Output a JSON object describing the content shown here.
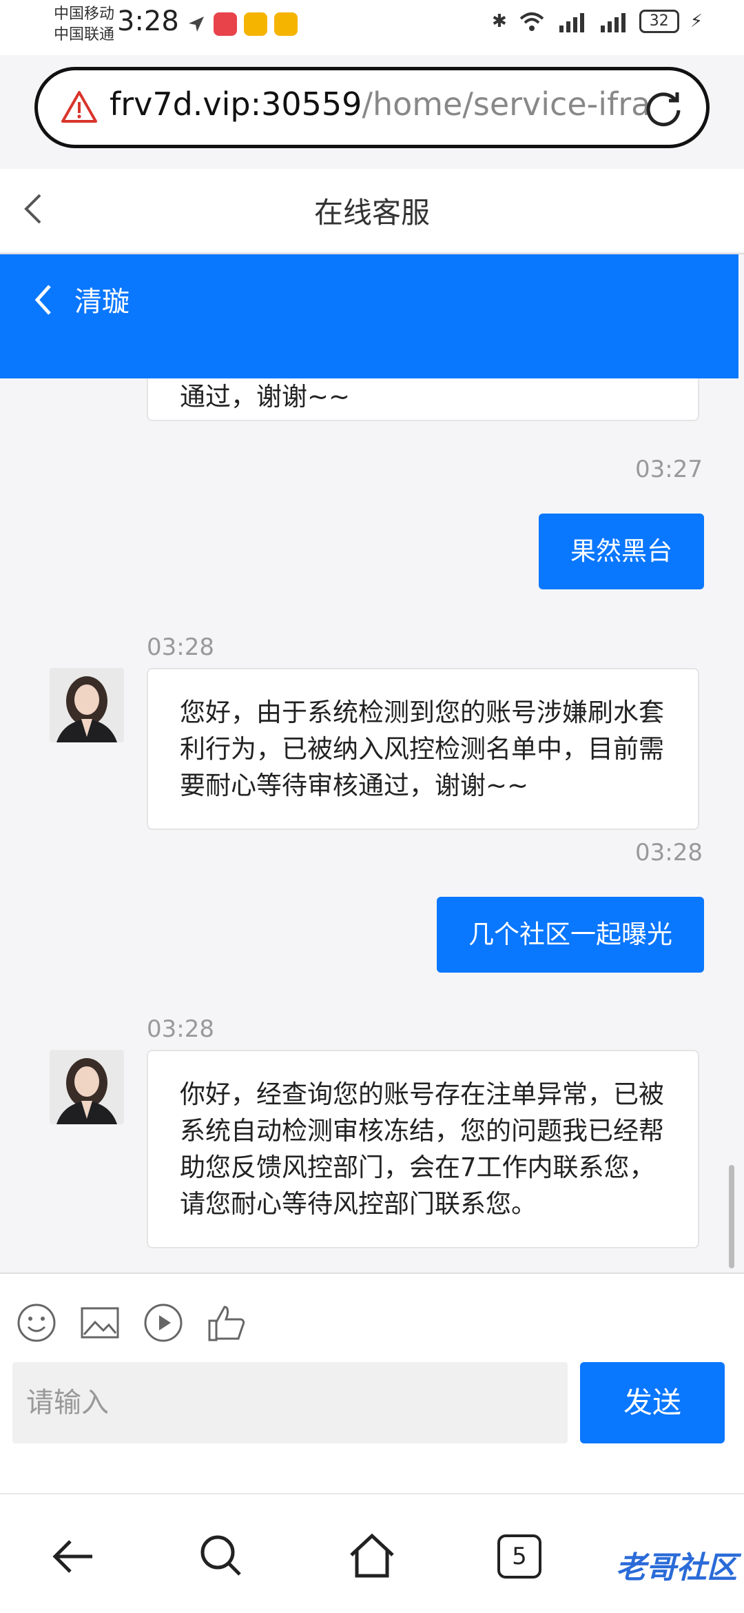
{
  "status_bar": {
    "carrier_1": "中国移动",
    "carrier_2": "中国联通",
    "time": "3:28",
    "battery": "32"
  },
  "browser": {
    "url_domain": "frv7d.vip:30559",
    "url_path": "/home/service-ifra"
  },
  "page": {
    "title": "在线客服"
  },
  "chat": {
    "contact_name": "清璇",
    "messages": [
      {
        "side": "left",
        "text": "通过，谢谢~~"
      },
      {
        "side": "right",
        "time": "03:27",
        "text": "果然黑台"
      },
      {
        "side": "left",
        "time": "03:28",
        "text": "您好，由于系统检测到您的账号涉嫌刷水套利行为，已被纳入风控检测名单中，目前需要耐心等待审核通过，谢谢~~"
      },
      {
        "side": "right",
        "time": "03:28",
        "text": "几个社区一起曝光"
      },
      {
        "side": "left",
        "time": "03:28",
        "text": "你好，经查询您的账号存在注单异常，已被系统自动检测审核冻结，您的问题我已经帮助您反馈风控部门，会在7工作内联系您，请您耐心等待风控部门联系您。"
      }
    ]
  },
  "input": {
    "placeholder": "请输入",
    "send_label": "发送"
  },
  "nav": {
    "tabs_count": "5"
  },
  "watermark": "老哥社区"
}
